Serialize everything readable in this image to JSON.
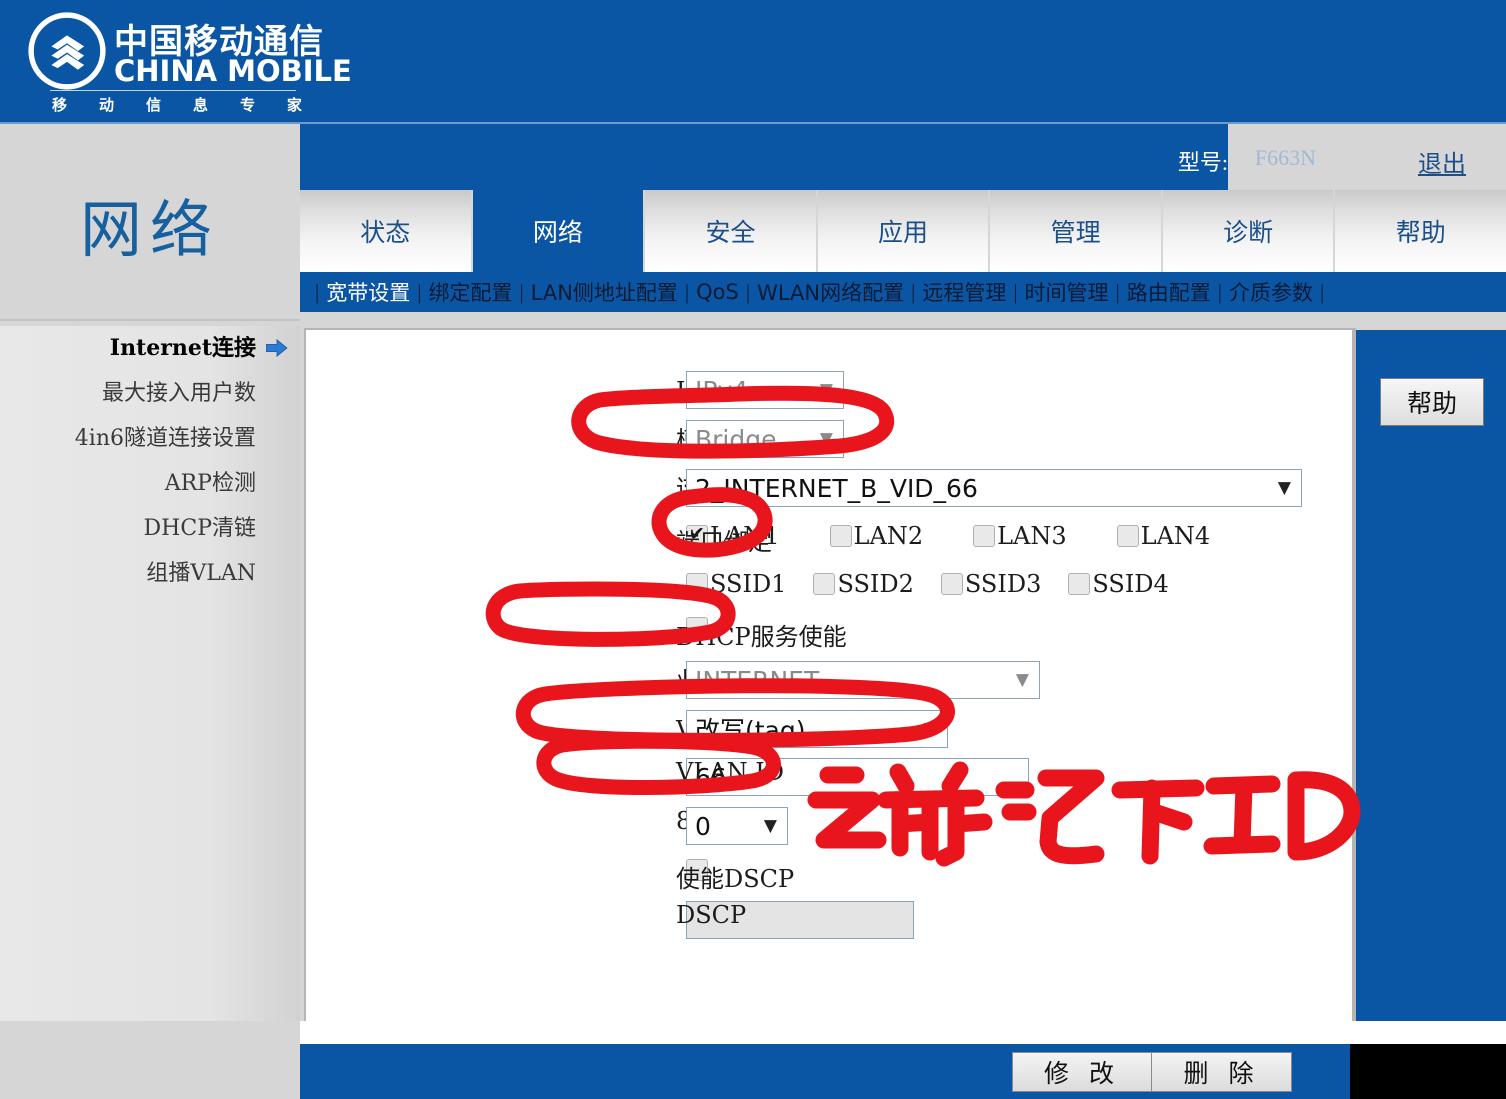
{
  "brand": {
    "name_cn": "中国移动通信",
    "name_en": "CHINA MOBILE",
    "slogan": "移动信息专家",
    "logo_icon": "china-mobile-logo"
  },
  "header": {
    "model_label": "型号:",
    "model_value": "F663N",
    "logout_label": "退出"
  },
  "section": {
    "title": "网络"
  },
  "tabs": [
    {
      "label": "状态",
      "active": false
    },
    {
      "label": "网络",
      "active": true
    },
    {
      "label": "安全",
      "active": false
    },
    {
      "label": "应用",
      "active": false
    },
    {
      "label": "管理",
      "active": false
    },
    {
      "label": "诊断",
      "active": false
    },
    {
      "label": "帮助",
      "active": false
    }
  ],
  "subnav": [
    {
      "label": "宽带设置",
      "active": true
    },
    {
      "label": "绑定配置",
      "active": false
    },
    {
      "label": "LAN侧地址配置",
      "active": false
    },
    {
      "label": "QoS",
      "active": false
    },
    {
      "label": "WLAN网络配置",
      "active": false
    },
    {
      "label": "远程管理",
      "active": false
    },
    {
      "label": "时间管理",
      "active": false
    },
    {
      "label": "路由配置",
      "active": false
    },
    {
      "label": "介质参数",
      "active": false
    }
  ],
  "sidebar": {
    "items": [
      {
        "label": "Internet连接",
        "active": true,
        "icon": "arrow-right-icon"
      },
      {
        "label": "最大接入用户数",
        "active": false
      },
      {
        "label": "4in6隧道连接设置",
        "active": false
      },
      {
        "label": "ARP检测",
        "active": false
      },
      {
        "label": "DHCP清链",
        "active": false
      },
      {
        "label": "组播VLAN",
        "active": false
      }
    ]
  },
  "help": {
    "button_label": "帮助"
  },
  "form": {
    "ip_version": {
      "label": "IP协议版本",
      "value": "IPv4",
      "disabled": true
    },
    "mode": {
      "label": "模式",
      "value": "Bridge",
      "disabled": true
    },
    "conn_name": {
      "label": "连接名称",
      "value": "2_INTERNET_B_VID_66",
      "disabled": false
    },
    "port_binding": {
      "label": "端口绑定",
      "lan": [
        {
          "label": "LAN1",
          "checked": true
        },
        {
          "label": "LAN2",
          "checked": false
        },
        {
          "label": "LAN3",
          "checked": false
        },
        {
          "label": "LAN4",
          "checked": false
        }
      ],
      "ssid": [
        {
          "label": "SSID1",
          "checked": false
        },
        {
          "label": "SSID2",
          "checked": false
        },
        {
          "label": "SSID3",
          "checked": false
        },
        {
          "label": "SSID4",
          "checked": false
        }
      ]
    },
    "dhcp_enable": {
      "label": "DHCP服务使能",
      "checked": false
    },
    "service_mode": {
      "label": "业务模式",
      "value": "INTERNET",
      "disabled": true
    },
    "vlan_mode": {
      "label": "VLAN 模式",
      "value": "改写(tag)",
      "disabled": false
    },
    "vlan_id": {
      "label": "VLAN ID",
      "value": "66",
      "disabled": false
    },
    "p8021p": {
      "label": "802.1p",
      "value": "0",
      "disabled": false
    },
    "dscp_enable": {
      "label": "使能DSCP",
      "checked": false
    },
    "dscp": {
      "label": "DSCP",
      "value": "",
      "disabled": true
    }
  },
  "footer": {
    "modify_label": "修 改",
    "delete_label": "删 除"
  },
  "annotation": {
    "handwriting": "之前记下ID",
    "ink_color": "#e8161c"
  },
  "colors": {
    "brand_blue": "#0a56a4",
    "panel_gray": "#d6d6d6",
    "title_blue": "#17609f",
    "ink_red": "#e8161c"
  }
}
